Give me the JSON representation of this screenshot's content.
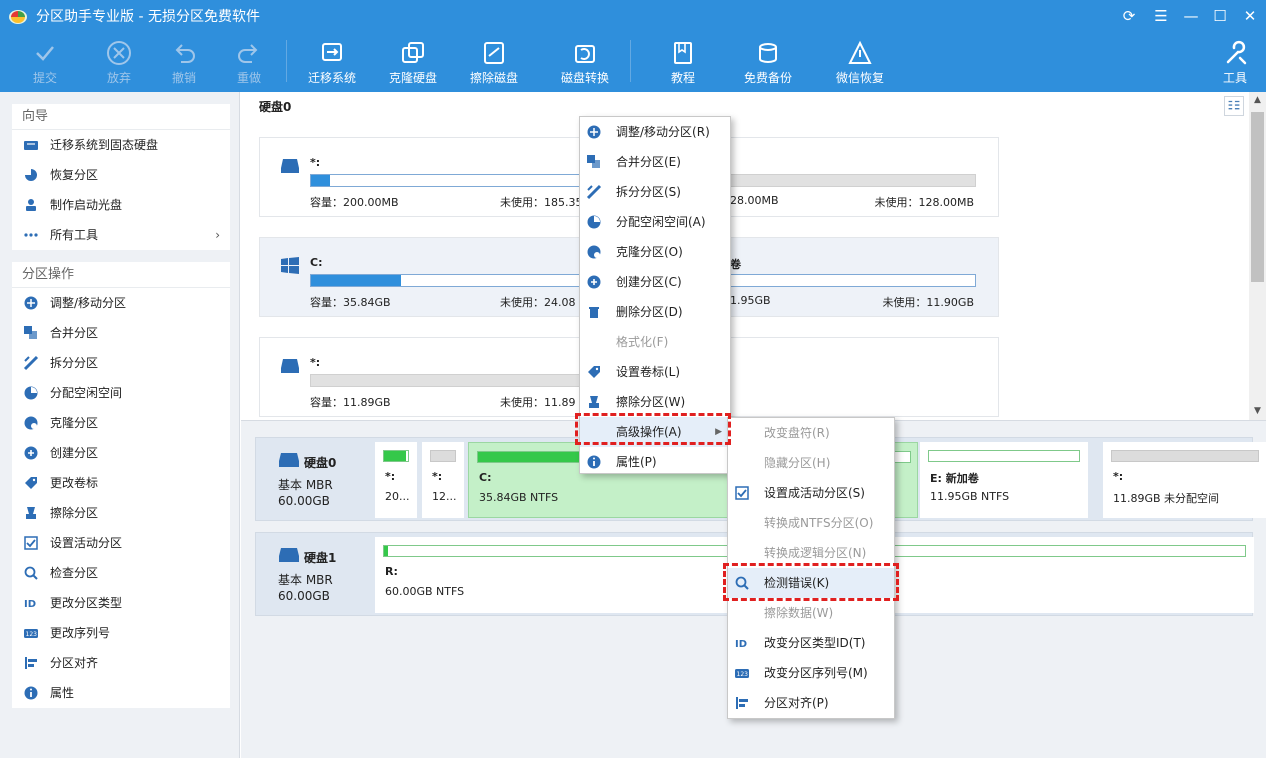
{
  "window": {
    "title": "分区助手专业版 - 无损分区免费软件",
    "controls": [
      "refresh-icon",
      "menu-icon",
      "minimize-icon",
      "maximize-icon",
      "close-icon"
    ]
  },
  "toolbar": {
    "items": [
      {
        "label": "提交",
        "icon": "check-icon",
        "disabled": true
      },
      {
        "label": "放弃",
        "icon": "cancel-icon",
        "disabled": true
      },
      {
        "label": "撤销",
        "icon": "undo-icon",
        "disabled": true
      },
      {
        "label": "重做",
        "icon": "redo-icon",
        "disabled": true
      },
      {
        "label": "迁移系统",
        "icon": "migrate-icon",
        "disabled": false
      },
      {
        "label": "克隆硬盘",
        "icon": "clone-disk-icon",
        "disabled": false
      },
      {
        "label": "擦除磁盘",
        "icon": "wipe-disk-icon",
        "disabled": false
      },
      {
        "label": "磁盘转换",
        "icon": "disk-convert-icon",
        "disabled": false
      },
      {
        "label": "教程",
        "icon": "book-icon",
        "disabled": false
      },
      {
        "label": "免费备份",
        "icon": "backup-icon",
        "disabled": false
      },
      {
        "label": "微信恢复",
        "icon": "recover-icon",
        "disabled": false
      }
    ],
    "tools_label": "工具"
  },
  "sidebar": {
    "guide": {
      "title": "向导",
      "items": [
        "迁移系统到固态硬盘",
        "恢复分区",
        "制作启动光盘",
        "所有工具"
      ]
    },
    "ops": {
      "title": "分区操作",
      "items": [
        "调整/移动分区",
        "合并分区",
        "拆分分区",
        "分配空闲空间",
        "克隆分区",
        "创建分区",
        "更改卷标",
        "擦除分区",
        "设置活动分区",
        "检查分区",
        "更改分区类型",
        "更改序列号",
        "分区对齐",
        "属性"
      ]
    }
  },
  "main": {
    "disk_heading": "硬盘0",
    "cards": [
      {
        "name": "*:",
        "cap": "容量：200.00MB",
        "free": "未使用：185.35",
        "fill": 0.07,
        "right_name": "",
        "right_cap": "28.00MB",
        "right_free": "未使用：128.00MB",
        "right_gray": true,
        "icon": "drive-icon"
      },
      {
        "name": "C:",
        "cap": "容量：35.84GB",
        "free": "未使用：24.08",
        "fill": 0.33,
        "right_name": "卷",
        "right_cap": "1.95GB",
        "right_free": "未使用：11.90GB",
        "right_gray": false,
        "icon": "windows-icon"
      },
      {
        "name": "*:",
        "cap": "容量：11.89GB",
        "free": "未使用：11.89",
        "fill": 0,
        "gray": true,
        "right_name": "",
        "right_cap": "",
        "right_free": "",
        "right_gray": false,
        "icon": "drive-icon"
      }
    ]
  },
  "disks": [
    {
      "name": "硬盘0",
      "type": "基本 MBR",
      "size": "60.00GB",
      "parts": [
        {
          "name": "*:",
          "desc": "20...",
          "fill": 0.9,
          "gray": false
        },
        {
          "name": "*:",
          "desc": "12...",
          "fill": 0,
          "gray": true
        },
        {
          "name": "C:",
          "desc": "35.84GB NTFS",
          "fill": 0.33,
          "gray": false,
          "selected": true
        },
        {
          "name": "E: 新加卷",
          "desc": "11.95GB NTFS",
          "fill": 0,
          "gray": false
        },
        {
          "name": "*:",
          "desc": "11.89GB 未分配空间",
          "fill": 0,
          "gray": true
        }
      ]
    },
    {
      "name": "硬盘1",
      "type": "基本 MBR",
      "size": "60.00GB",
      "parts": [
        {
          "name": "R:",
          "desc": "60.00GB NTFS",
          "fill": 0.005,
          "gray": false
        }
      ]
    }
  ],
  "context_menu": {
    "items": [
      {
        "label": "调整/移动分区(R)",
        "icon": "resize-icon",
        "disabled": false
      },
      {
        "label": "合并分区(E)",
        "icon": "merge-icon",
        "disabled": false
      },
      {
        "label": "拆分分区(S)",
        "icon": "split-icon",
        "disabled": false
      },
      {
        "label": "分配空闲空间(A)",
        "icon": "allocate-icon",
        "disabled": false
      },
      {
        "label": "克隆分区(O)",
        "icon": "clone-icon",
        "disabled": false
      },
      {
        "label": "创建分区(C)",
        "icon": "create-icon",
        "disabled": false
      },
      {
        "label": "删除分区(D)",
        "icon": "delete-icon",
        "disabled": false
      },
      {
        "label": "格式化(F)",
        "icon": "format-icon",
        "disabled": true
      },
      {
        "label": "设置卷标(L)",
        "icon": "label-icon",
        "disabled": false
      },
      {
        "label": "擦除分区(W)",
        "icon": "wipe-icon",
        "disabled": false
      },
      {
        "label": "高级操作(A)",
        "icon": "advanced-icon",
        "disabled": false,
        "submenu": true
      },
      {
        "label": "属性(P)",
        "icon": "info-icon",
        "disabled": false
      }
    ]
  },
  "submenu": {
    "items": [
      {
        "label": "改变盘符(R)",
        "icon": "none",
        "disabled": true
      },
      {
        "label": "隐藏分区(H)",
        "icon": "none",
        "disabled": true
      },
      {
        "label": "设置成活动分区(S)",
        "icon": "active-icon",
        "disabled": false
      },
      {
        "label": "转换成NTFS分区(O)",
        "icon": "none",
        "disabled": true
      },
      {
        "label": "转换成逻辑分区(N)",
        "icon": "none",
        "disabled": true
      },
      {
        "label": "检测错误(K)",
        "icon": "check-error-icon",
        "disabled": false,
        "highlight": true
      },
      {
        "label": "擦除数据(W)",
        "icon": "none",
        "disabled": true
      },
      {
        "label": "改变分区类型ID(T)",
        "icon": "id-icon",
        "disabled": false
      },
      {
        "label": "改变分区序列号(M)",
        "icon": "serial-icon",
        "disabled": false
      },
      {
        "label": "分区对齐(P)",
        "icon": "align-icon",
        "disabled": false
      }
    ]
  },
  "colors": {
    "accent": "#2f8fdc",
    "highlight_dash": "#e02020",
    "used_green": "#35c84a"
  }
}
